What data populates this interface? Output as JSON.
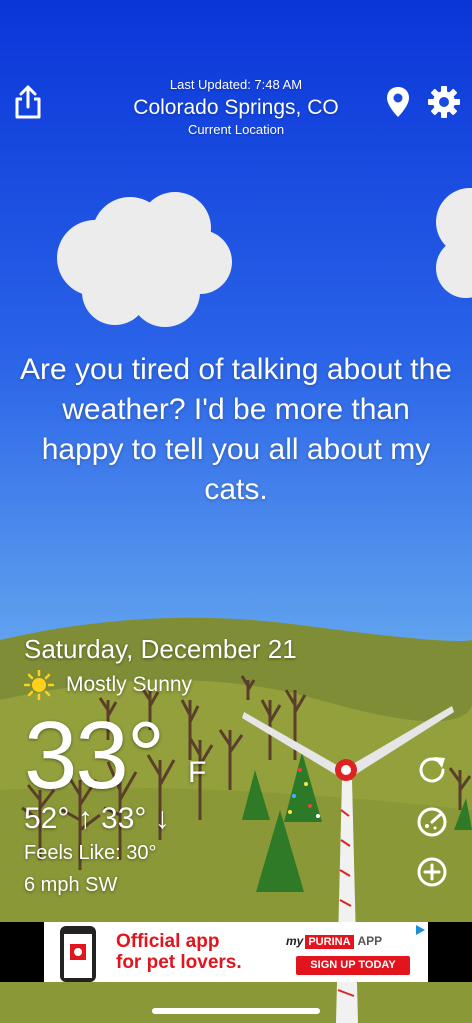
{
  "header": {
    "last_updated": "Last Updated: 7:48 AM",
    "city": "Colorado Springs, CO",
    "location_label": "Current Location"
  },
  "icons": {
    "share": "share-icon",
    "location": "location-pin-icon",
    "settings": "gear-icon",
    "refresh": "refresh-icon",
    "radar": "radar-icon",
    "add": "plus-icon",
    "condition": "sun-icon"
  },
  "quip": "Are you tired of talking about the weather? I'd be more than happy to tell you all about my cats.",
  "weather": {
    "date": "Saturday, December 21",
    "condition": "Mostly Sunny",
    "temperature": "33°",
    "unit": "F",
    "hi_lo": "52° ↑ 33° ↓",
    "feels_like": "Feels Like: 30°",
    "wind": "6 mph SW"
  },
  "ad": {
    "line1": "Official app",
    "line2": "for pet lovers.",
    "brand_prefix": "my",
    "brand": "PURINA",
    "brand_suffix": "APP",
    "cta": "SIGN UP TODAY"
  },
  "colors": {
    "sky_top": "#0a35d8",
    "hill": "#8e9a3c",
    "ad_red": "#e2141e"
  }
}
